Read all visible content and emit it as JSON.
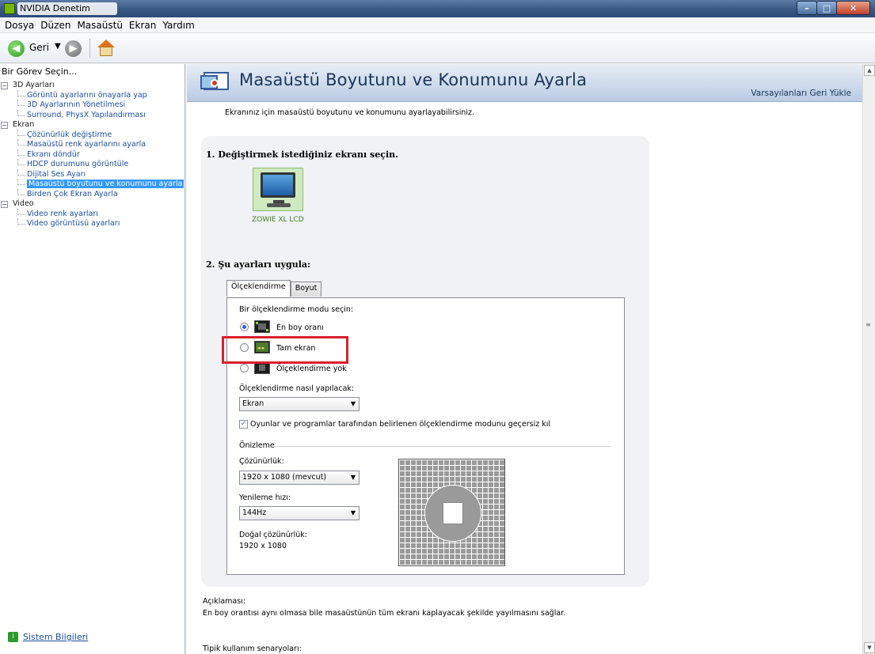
{
  "window": {
    "title": "NVIDIA Denetim Masası"
  },
  "menubar": {
    "items": [
      "Dosya",
      "Düzen",
      "Masaüstü",
      "Ekran",
      "Yardım"
    ]
  },
  "toolbar": {
    "back_label": "Geri"
  },
  "left_panel": {
    "header": "Bir Görev Seçin...",
    "tree": [
      {
        "type": "category",
        "label": "3D Ayarları"
      },
      {
        "type": "item",
        "label": "Görüntü ayarlarını önayarla yap"
      },
      {
        "type": "item",
        "label": "3D Ayarlarının Yönetilmesi"
      },
      {
        "type": "item",
        "label": "Surround, PhysX Yapılandırması"
      },
      {
        "type": "category",
        "label": "Ekran"
      },
      {
        "type": "item",
        "label": "Çözünürlük değiştirme"
      },
      {
        "type": "item",
        "label": "Masaüstü renk ayarlarını ayarla"
      },
      {
        "type": "item",
        "label": "Ekranı döndür"
      },
      {
        "type": "item",
        "label": "HDCP durumunu görüntüle"
      },
      {
        "type": "item",
        "label": "Dijital Ses Ayarı"
      },
      {
        "type": "item",
        "label": "Masaüstü boyutunu ve konumunu ayarla",
        "selected": true
      },
      {
        "type": "item",
        "label": "Birden Çok Ekran Ayarla"
      },
      {
        "type": "category",
        "label": "Video"
      },
      {
        "type": "item",
        "label": "Video renk ayarları"
      },
      {
        "type": "item",
        "label": "Video görüntüsü ayarları"
      }
    ],
    "system_info_link": "Sistem Bilgileri"
  },
  "main": {
    "title": "Masaüstü Boyutunu ve Konumunu Ayarla",
    "restore_defaults": "Varsayılanları Geri Yükle",
    "description": "Ekranınız için masaüstü boyutunu ve konumunu ayarlayabilirsiniz.",
    "step1": "1. Değiştirmek istediğiniz ekranı seçin.",
    "display_name": "ZOWIE XL LCD",
    "step2": "2. Şu ayarları uygula:",
    "tabs": [
      "Ölçeklendirme",
      "Boyut"
    ],
    "scaling": {
      "prompt": "Bir ölçeklendirme modu seçin:",
      "modes": [
        {
          "label": "En boy oranı",
          "checked": true
        },
        {
          "label": "Tam ekran",
          "checked": false
        },
        {
          "label": "Ölçeklendirme yok",
          "checked": false
        }
      ],
      "perform_label": "Ölçeklendirme nasıl yapılacak:",
      "perform_value": "Ekran",
      "override_label": "Oyunlar ve programlar tarafından belirlenen ölçeklendirme modunu geçersiz kıl",
      "override_checked": true,
      "preview_label": "Önizleme",
      "resolution_label": "Çözünürlük:",
      "resolution_value": "1920 x 1080 (mevcut)",
      "refresh_label": "Yenileme hızı:",
      "refresh_value": "144Hz",
      "native_label": "Doğal çözünürlük:",
      "native_value": "1920 x 1080"
    },
    "explanation_label": "Açıklaması:",
    "explanation_text": "En boy orantısı aynı olmasa bile masaüstünün tüm ekranı kaplayacak şekilde yayılmasını sağlar.",
    "typical_label": "Tipik kullanım senaryoları:"
  },
  "colors": {
    "highlight": "#d9212c",
    "selected": "#3399ff",
    "link": "#1a4ea2"
  }
}
